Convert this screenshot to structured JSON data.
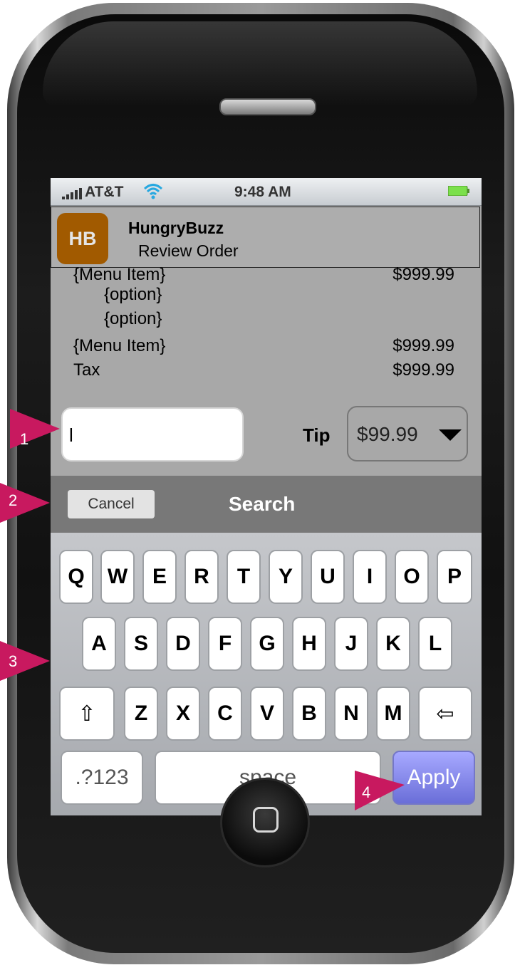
{
  "status_bar": {
    "carrier": "AT&T",
    "time": "9:48 AM"
  },
  "app": {
    "logo_text": "HB",
    "name": "HungryBuzz",
    "subtitle": "Review Order"
  },
  "order": {
    "items": [
      {
        "label": "{Menu Item}",
        "price": "$999.99"
      },
      {
        "label": "{option}",
        "price": ""
      },
      {
        "label": "{option}",
        "price": ""
      },
      {
        "label": "{Menu Item}",
        "price": "$999.99"
      },
      {
        "label": "Tax",
        "price": "$999.99"
      }
    ]
  },
  "tip": {
    "input_value": "l",
    "label": "Tip",
    "selected": "$99.99"
  },
  "search_bar": {
    "cancel_label": "Cancel",
    "title": "Search"
  },
  "keyboard": {
    "row1": [
      "Q",
      "W",
      "E",
      "R",
      "T",
      "Y",
      "U",
      "I",
      "O",
      "P"
    ],
    "row2": [
      "A",
      "S",
      "D",
      "F",
      "G",
      "H",
      "J",
      "K",
      "L"
    ],
    "row3": [
      "Z",
      "X",
      "C",
      "V",
      "B",
      "N",
      "M"
    ],
    "shift_glyph": "⇧",
    "backspace_glyph": "⇦",
    "numbers_label": ".?123",
    "space_label": "space",
    "apply_label": "Apply"
  },
  "callouts": [
    "1",
    "2",
    "3",
    "4"
  ],
  "colors": {
    "callout": "#c8195f",
    "logo": "#a15a00",
    "apply": "#7a7dde"
  }
}
